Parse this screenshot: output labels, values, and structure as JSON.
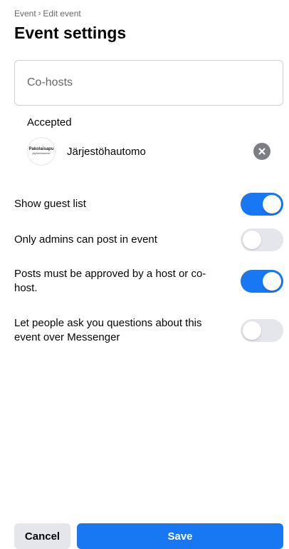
{
  "breadcrumb": {
    "parent": "Event",
    "separator": "›",
    "current": "Edit event"
  },
  "page": {
    "title": "Event settings"
  },
  "cohosts": {
    "placeholder": "Co-hosts",
    "accepted_label": "Accepted",
    "hosts": [
      {
        "name": "Järjestöhautomo",
        "logo_main": "Pakolaisapu",
        "logo_sub": "järjestöhautomo"
      }
    ]
  },
  "settings": [
    {
      "label": "Show guest list",
      "enabled": true
    },
    {
      "label": "Only admins can post in event",
      "enabled": false
    },
    {
      "label": "Posts must be approved by a host or co-host.",
      "enabled": true
    },
    {
      "label": "Let people ask you questions about this event over Messenger",
      "enabled": false
    }
  ],
  "buttons": {
    "cancel": "Cancel",
    "save": "Save"
  },
  "colors": {
    "accent": "#1877f2",
    "toggle_off": "#e4e6eb",
    "secondary_button": "#e4e6eb"
  },
  "icons": {
    "remove": "close-circle-icon",
    "breadcrumb_sep": "chevron-right-icon"
  }
}
